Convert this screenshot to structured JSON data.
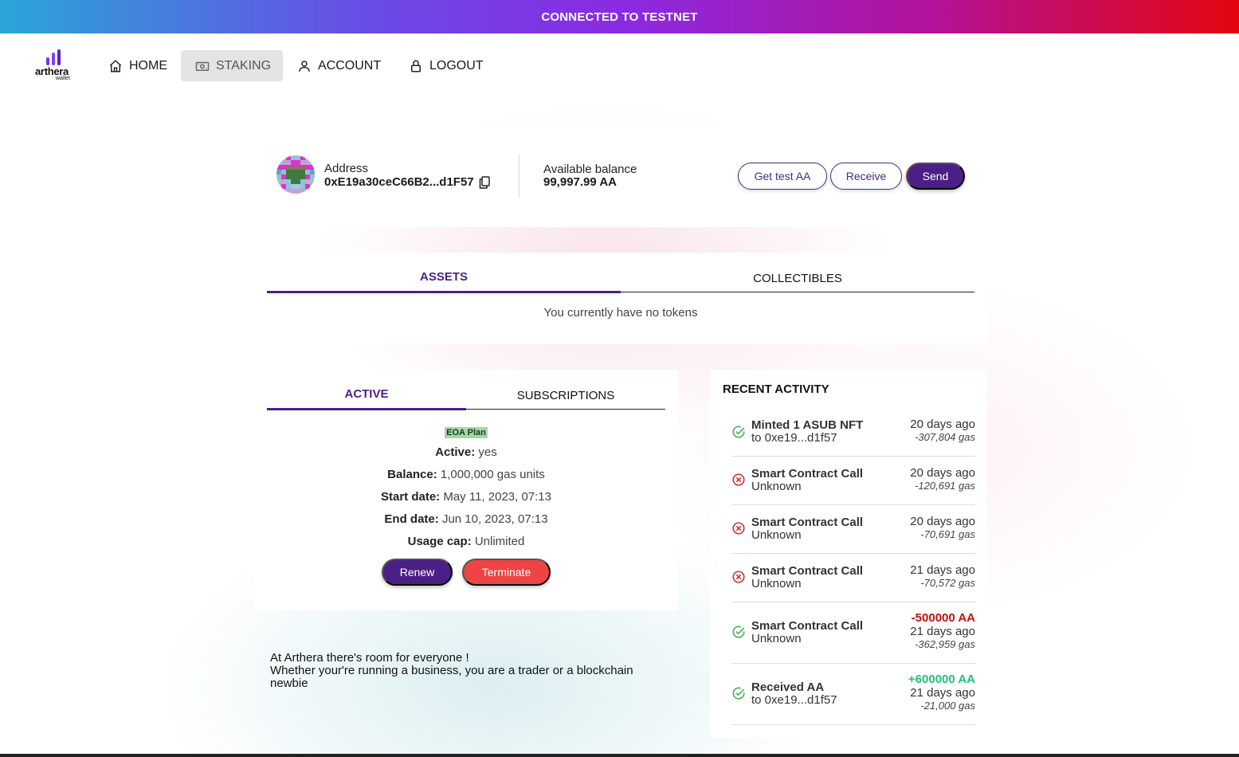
{
  "banner": {
    "text": "CONNECTED TO TESTNET"
  },
  "logo": {
    "word": "arthera",
    "sub": "wallet"
  },
  "nav": {
    "home": "HOME",
    "staking": "STAKING",
    "account": "ACCOUNT",
    "logout": "LOGOUT",
    "active": "STAKING"
  },
  "wallet": {
    "address_label": "Address",
    "address": "0xE19a30ceC66B2...d1F57",
    "balance_label": "Available balance",
    "balance": "99,997.99 AA",
    "buttons": {
      "get_test": "Get test AA",
      "receive": "Receive",
      "send": "Send"
    }
  },
  "assets": {
    "tabs": [
      "ASSETS",
      "COLLECTIBLES"
    ],
    "active_tab": "ASSETS",
    "empty_text": "You currently have no tokens"
  },
  "subscription": {
    "tabs": [
      "ACTIVE",
      "SUBSCRIPTIONS"
    ],
    "active_tab": "ACTIVE",
    "plan": "EOA Plan",
    "fields": [
      {
        "label": "Active:",
        "value": "yes"
      },
      {
        "label": "Balance:",
        "value": "1,000,000 gas units"
      },
      {
        "label": "Start date:",
        "value": "May 11, 2023, 07:13"
      },
      {
        "label": "End date:",
        "value": "Jun 10, 2023, 07:13"
      },
      {
        "label": "Usage cap:",
        "value": "Unlimited"
      }
    ],
    "buttons": {
      "renew": "Renew",
      "terminate": "Terminate"
    }
  },
  "activity": {
    "title": "RECENT ACTIVITY",
    "items": [
      {
        "status": "success",
        "name": "Minted 1 ASUB NFT",
        "sub": "to 0xe19...d1f57",
        "amount": "",
        "time": "20 days ago",
        "gas": "-307,804 gas"
      },
      {
        "status": "failed",
        "name": "Smart Contract Call",
        "sub": "Unknown",
        "amount": "",
        "time": "20 days ago",
        "gas": "-120,691 gas"
      },
      {
        "status": "failed",
        "name": "Smart Contract Call",
        "sub": "Unknown",
        "amount": "",
        "time": "20 days ago",
        "gas": "-70,691 gas"
      },
      {
        "status": "failed",
        "name": "Smart Contract Call",
        "sub": "Unknown",
        "amount": "",
        "time": "21 days ago",
        "gas": "-70,572 gas"
      },
      {
        "status": "success",
        "name": "Smart Contract Call",
        "sub": "Unknown",
        "amount": "-500000 AA",
        "time": "21 days ago",
        "gas": "-362,959 gas"
      },
      {
        "status": "success",
        "name": "Received AA",
        "sub": "to 0xe19...d1f57",
        "amount": "+600000 AA",
        "time": "21 days ago",
        "gas": "-21,000 gas"
      }
    ]
  },
  "tagline": {
    "line1": "At Arthera there's room for everyone !",
    "line2": "Whether your're running a business, you are a trader or a blockchain newbie"
  },
  "colors": {
    "accent": "#4b1f86",
    "danger": "#ef4444",
    "negative": "#c81010",
    "positive": "#22c07a",
    "success_icon": "#4caf50",
    "failed_icon": "#d32f2f"
  }
}
